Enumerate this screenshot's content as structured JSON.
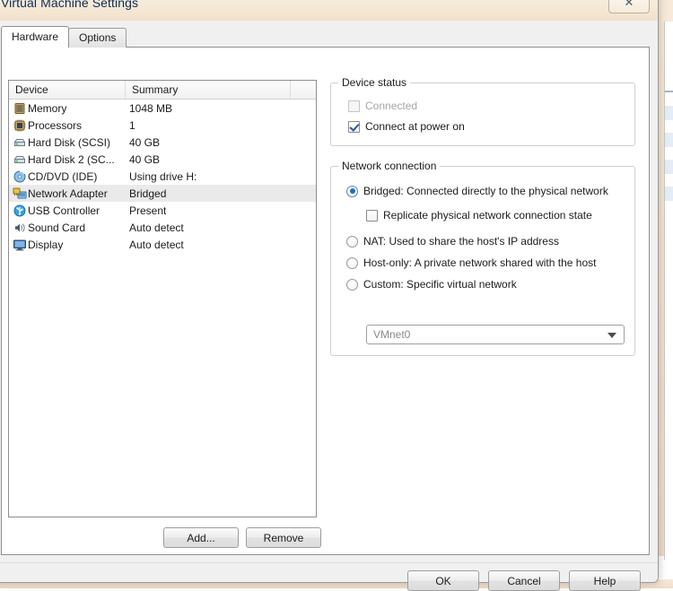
{
  "window": {
    "title": "Virtual Machine Settings",
    "close_label": "✕"
  },
  "tabs": [
    {
      "label": "Hardware",
      "active": true
    },
    {
      "label": "Options",
      "active": false
    }
  ],
  "device_list": {
    "columns": [
      "Device",
      "Summary",
      ""
    ],
    "rows": [
      {
        "icon": "memory-icon",
        "device": "Memory",
        "summary": "1048 MB",
        "selected": false
      },
      {
        "icon": "processor-icon",
        "device": "Processors",
        "summary": "1",
        "selected": false
      },
      {
        "icon": "hard-disk-icon",
        "device": "Hard Disk (SCSI)",
        "summary": "40 GB",
        "selected": false
      },
      {
        "icon": "hard-disk-icon",
        "device": "Hard Disk 2 (SC...",
        "summary": "40 GB",
        "selected": false
      },
      {
        "icon": "cd-dvd-icon",
        "device": "CD/DVD (IDE)",
        "summary": "Using drive H:",
        "selected": false
      },
      {
        "icon": "network-adapter-icon",
        "device": "Network Adapter",
        "summary": "Bridged",
        "selected": true
      },
      {
        "icon": "usb-controller-icon",
        "device": "USB Controller",
        "summary": "Present",
        "selected": false
      },
      {
        "icon": "sound-card-icon",
        "device": "Sound Card",
        "summary": "Auto detect",
        "selected": false
      },
      {
        "icon": "display-icon",
        "device": "Display",
        "summary": "Auto detect",
        "selected": false
      }
    ],
    "add_label": "Add...",
    "remove_label": "Remove"
  },
  "device_status": {
    "legend": "Device status",
    "connected_label": "Connected",
    "connected_checked": false,
    "connected_disabled": true,
    "connect_at_power_on_label": "Connect at power on",
    "connect_at_power_on_checked": true
  },
  "network_connection": {
    "legend": "Network connection",
    "options": [
      {
        "label": "Bridged: Connected directly to the physical network",
        "selected": true
      },
      {
        "label": "NAT: Used to share the host's IP address",
        "selected": false
      },
      {
        "label": "Host-only: A private network shared with the host",
        "selected": false
      },
      {
        "label": "Custom: Specific virtual network",
        "selected": false
      }
    ],
    "replicate_label": "Replicate physical network connection state",
    "replicate_checked": false,
    "vmnet_value": "VMnet0"
  },
  "footer": {
    "ok_label": "OK",
    "cancel_label": "Cancel",
    "help_label": "Help"
  },
  "colors": {
    "accent": "#1e6fc4",
    "title_text": "#0d2b52",
    "dialog_bg": "#f0f0f0",
    "panel_bg": "#ffffff",
    "selection": "#eaeaea",
    "desktop": "#f3e3d0"
  }
}
